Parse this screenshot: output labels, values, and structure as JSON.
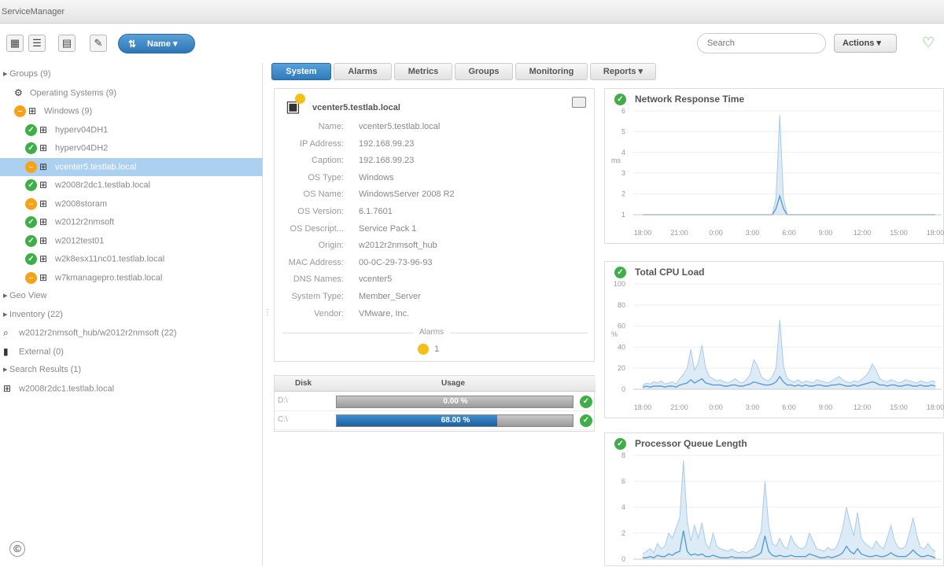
{
  "app": {
    "title": "ServiceManager"
  },
  "toolbar": {
    "name_button": "Name",
    "search_placeholder": "Search",
    "actions_label": "Actions"
  },
  "tree": [
    {
      "label": "Groups (9)",
      "indent": 0,
      "status": "",
      "icon": "expand",
      "selected": false
    },
    {
      "label": "Operating Systems (9)",
      "indent": 1,
      "status": "",
      "icon": "os-group",
      "selected": false
    },
    {
      "label": "Windows (9)",
      "indent": 1,
      "status": "warn",
      "icon": "windows",
      "selected": false
    },
    {
      "label": "hyperv04DH1",
      "indent": 2,
      "status": "ok",
      "icon": "windows",
      "selected": false
    },
    {
      "label": "hyperv04DH2",
      "indent": 2,
      "status": "ok",
      "icon": "windows",
      "selected": false
    },
    {
      "label": "vcenter5.testlab.local",
      "indent": 2,
      "status": "warn",
      "icon": "windows",
      "selected": true
    },
    {
      "label": "w2008r2dc1.testlab.local",
      "indent": 2,
      "status": "ok",
      "icon": "windows",
      "selected": false
    },
    {
      "label": "w2008storam",
      "indent": 2,
      "status": "warn",
      "icon": "windows",
      "selected": false
    },
    {
      "label": "w2012r2nmsoft",
      "indent": 2,
      "status": "ok",
      "icon": "windows",
      "selected": false
    },
    {
      "label": "w2012test01",
      "indent": 2,
      "status": "ok",
      "icon": "windows",
      "selected": false
    },
    {
      "label": "w2k8esx11nc01.testlab.local",
      "indent": 2,
      "status": "ok",
      "icon": "windows",
      "selected": false
    },
    {
      "label": "w7kmanagepro.testlab.local",
      "indent": 2,
      "status": "warn",
      "icon": "windows",
      "selected": false
    },
    {
      "label": "Geo View",
      "indent": 0,
      "status": "",
      "icon": "expand",
      "selected": false
    },
    {
      "label": "Inventory (22)",
      "indent": 0,
      "status": "",
      "icon": "expand",
      "selected": false
    },
    {
      "label": "w2012r2nmsoft_hub/w2012r2nmsoft (22)",
      "indent": 0,
      "status": "",
      "icon": "search",
      "selected": false
    },
    {
      "label": "External (0)",
      "indent": 0,
      "status": "",
      "icon": "server",
      "selected": false
    },
    {
      "label": "Search Results (1)",
      "indent": 0,
      "status": "",
      "icon": "expand",
      "selected": false
    },
    {
      "label": "w2008r2dc1.testlab.local",
      "indent": 0,
      "status": "",
      "icon": "windows",
      "selected": false
    }
  ],
  "tabs": [
    "System",
    "Alarms",
    "Metrics",
    "Groups",
    "Monitoring",
    "Reports"
  ],
  "active_tab": "System",
  "system": {
    "title": "vcenter5.testlab.local",
    "properties": [
      {
        "label": "Name:",
        "value": "vcenter5.testlab.local"
      },
      {
        "label": "IP Address:",
        "value": "192.168.99.23"
      },
      {
        "label": "Caption:",
        "value": "192.168.99.23"
      },
      {
        "label": "OS Type:",
        "value": "Windows"
      },
      {
        "label": "OS Name:",
        "value": "WindowsServer 2008 R2"
      },
      {
        "label": "OS Version:",
        "value": "6.1.7601"
      },
      {
        "label": "OS Descript...",
        "value": "Service Pack 1"
      },
      {
        "label": "Origin:",
        "value": "w2012r2nmsoft_hub"
      },
      {
        "label": "MAC Address:",
        "value": "00-0C-29-73-96-93"
      },
      {
        "label": "DNS Names:",
        "value": "vcenter5"
      },
      {
        "label": "System Type:",
        "value": "Member_Server"
      },
      {
        "label": "Vendor:",
        "value": "VMware, Inc."
      }
    ],
    "alarms_label": "Alarms",
    "alarms_count": "1"
  },
  "disks": {
    "headers": {
      "disk": "Disk",
      "usage": "Usage"
    },
    "rows": [
      {
        "name": "D:\\",
        "usage": 0.0,
        "label": "0.00 %",
        "status": "ok"
      },
      {
        "name": "C:\\",
        "usage": 0.68,
        "label": "68.00 %",
        "status": "ok"
      }
    ]
  },
  "colors": {
    "ok": "#3fae49",
    "warn": "#f6a21b",
    "accent": "#2f7ab9",
    "series": "#5b9bd5"
  },
  "chart_data": [
    {
      "type": "area",
      "title": "Network Response Time",
      "ylabel": "ms",
      "yticks": [
        "1",
        "2",
        "3",
        "4",
        "5",
        "6"
      ],
      "ylim": [
        1,
        6
      ],
      "xticks": [
        "18:00",
        "21:00",
        "0:00",
        "3:00",
        "6:00",
        "9:00",
        "12:00",
        "15:00",
        "18:00"
      ],
      "series": [
        {
          "values": [
            1,
            1,
            1,
            1,
            1,
            1,
            1,
            1,
            1,
            1,
            1,
            1,
            1,
            1,
            1,
            1,
            1,
            1,
            1,
            1,
            1,
            1,
            1,
            1,
            1,
            1,
            1,
            1,
            1,
            1,
            1,
            1,
            1,
            1,
            1,
            1,
            1.8,
            5.8,
            1.8,
            1,
            1,
            1,
            1,
            1,
            1,
            1,
            1,
            1,
            1,
            1,
            1,
            1,
            1,
            1,
            1,
            1,
            1,
            1,
            1,
            1,
            1,
            1,
            1,
            1,
            1,
            1,
            1,
            1,
            1,
            1,
            1,
            1,
            1,
            1,
            1,
            1,
            1,
            1,
            1,
            1
          ]
        },
        {
          "values": [
            1,
            1,
            1,
            1,
            1,
            1,
            1,
            1,
            1,
            1,
            1,
            1,
            1,
            1,
            1,
            1,
            1,
            1,
            1,
            1,
            1,
            1,
            1,
            1,
            1,
            1,
            1,
            1,
            1,
            1,
            1,
            1,
            1,
            1,
            1,
            1,
            1.3,
            1.9,
            1.3,
            1,
            1,
            1,
            1,
            1,
            1,
            1,
            1,
            1,
            1,
            1,
            1,
            1,
            1,
            1,
            1,
            1,
            1,
            1,
            1,
            1,
            1,
            1,
            1,
            1,
            1,
            1,
            1,
            1,
            1,
            1,
            1,
            1,
            1,
            1,
            1,
            1,
            1,
            1,
            1,
            1
          ]
        }
      ]
    },
    {
      "type": "area",
      "title": "Total CPU Load",
      "ylabel": "%",
      "yticks": [
        "0",
        "20",
        "40",
        "60",
        "80",
        "100"
      ],
      "ylim": [
        0,
        100
      ],
      "xticks": [
        "18:00",
        "21:00",
        "0:00",
        "3:00",
        "6:00",
        "9:00",
        "12:00",
        "15:00",
        "18:00"
      ],
      "series": [
        {
          "values": [
            4,
            6,
            5,
            7,
            6,
            8,
            5,
            6,
            7,
            5,
            10,
            14,
            20,
            38,
            18,
            25,
            42,
            20,
            12,
            10,
            8,
            9,
            7,
            6,
            8,
            10,
            7,
            6,
            9,
            14,
            28,
            22,
            12,
            9,
            8,
            12,
            20,
            66,
            22,
            10,
            8,
            7,
            9,
            6,
            8,
            7,
            6,
            9,
            8,
            7,
            6,
            8,
            10,
            12,
            9,
            7,
            6,
            8,
            7,
            9,
            12,
            16,
            24,
            18,
            10,
            8,
            7,
            9,
            8,
            6,
            7,
            9,
            8,
            7,
            6,
            8,
            7,
            6,
            8,
            7
          ]
        },
        {
          "values": [
            2,
            3,
            2,
            3,
            3,
            3,
            2,
            3,
            3,
            2,
            4,
            5,
            6,
            9,
            6,
            8,
            10,
            6,
            5,
            4,
            4,
            4,
            3,
            3,
            4,
            4,
            3,
            3,
            4,
            5,
            7,
            6,
            5,
            4,
            4,
            5,
            7,
            12,
            7,
            4,
            4,
            3,
            4,
            3,
            4,
            3,
            3,
            4,
            4,
            3,
            3,
            4,
            4,
            5,
            4,
            3,
            3,
            4,
            3,
            4,
            5,
            6,
            7,
            6,
            4,
            4,
            3,
            4,
            4,
            3,
            3,
            4,
            4,
            3,
            3,
            4,
            3,
            3,
            4,
            3
          ]
        }
      ]
    },
    {
      "type": "area",
      "title": "Processor Queue Length",
      "ylabel": "",
      "yticks": [
        "0",
        "2",
        "4",
        "6",
        "8"
      ],
      "ylim": [
        0,
        8
      ],
      "xticks": [],
      "series": [
        {
          "values": [
            0.4,
            0.6,
            0.8,
            0.5,
            1.2,
            0.8,
            1.0,
            2.0,
            1.6,
            2.4,
            3.2,
            7.6,
            3.0,
            1.4,
            2.6,
            1.6,
            2.8,
            1.2,
            0.8,
            2.0,
            1.0,
            0.8,
            0.7,
            0.6,
            0.8,
            0.6,
            0.5,
            0.6,
            0.5,
            0.7,
            0.8,
            1.4,
            2.2,
            6.0,
            2.6,
            1.2,
            1.0,
            1.6,
            1.0,
            0.8,
            1.8,
            1.2,
            0.9,
            0.8,
            1.0,
            2.0,
            1.4,
            0.8,
            0.7,
            0.6,
            0.9,
            0.7,
            0.8,
            1.4,
            2.4,
            4.0,
            2.8,
            1.8,
            3.6,
            1.6,
            1.2,
            1.0,
            0.8,
            1.4,
            1.0,
            0.8,
            1.6,
            2.6,
            1.4,
            0.9,
            0.8,
            1.0,
            2.0,
            3.2,
            1.8,
            0.9,
            0.8,
            1.2,
            0.8,
            0.6
          ]
        },
        {
          "values": [
            0.1,
            0.1,
            0.2,
            0.1,
            0.3,
            0.2,
            0.2,
            0.4,
            0.3,
            0.5,
            0.6,
            2.2,
            0.6,
            0.3,
            0.4,
            0.3,
            0.4,
            0.2,
            0.2,
            0.3,
            0.2,
            0.1,
            0.1,
            0.1,
            0.2,
            0.1,
            0.1,
            0.1,
            0.1,
            0.1,
            0.2,
            0.3,
            0.5,
            1.8,
            0.6,
            0.3,
            0.2,
            0.3,
            0.2,
            0.2,
            0.3,
            0.2,
            0.2,
            0.2,
            0.2,
            0.4,
            0.3,
            0.2,
            0.1,
            0.1,
            0.2,
            0.1,
            0.2,
            0.3,
            0.5,
            1.0,
            0.6,
            0.4,
            0.8,
            0.4,
            0.3,
            0.2,
            0.2,
            0.3,
            0.2,
            0.2,
            0.3,
            0.5,
            0.3,
            0.2,
            0.2,
            0.2,
            0.4,
            0.7,
            0.4,
            0.2,
            0.2,
            0.3,
            0.2,
            0.1
          ]
        }
      ]
    }
  ]
}
